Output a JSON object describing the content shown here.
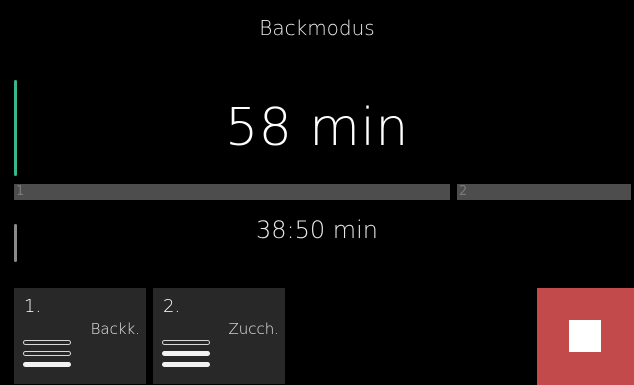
{
  "header": {
    "title": "Backmodus"
  },
  "timer": {
    "main": "58 min",
    "sub": "38:50 min"
  },
  "progress": {
    "segments": [
      {
        "label": "1"
      },
      {
        "label": "2"
      }
    ]
  },
  "steps": [
    {
      "number": "1.",
      "label": "Backk.",
      "level": 1,
      "max_level": 3
    },
    {
      "number": "2.",
      "label": "Zucch.",
      "level": 2,
      "max_level": 3
    }
  ],
  "colors": {
    "accent_green": "#38b78f",
    "stop_red": "#c24a4a",
    "card_bg": "#282828",
    "progress_bg": "#4d4d4d"
  },
  "icons": {
    "stop": "stop-icon"
  }
}
